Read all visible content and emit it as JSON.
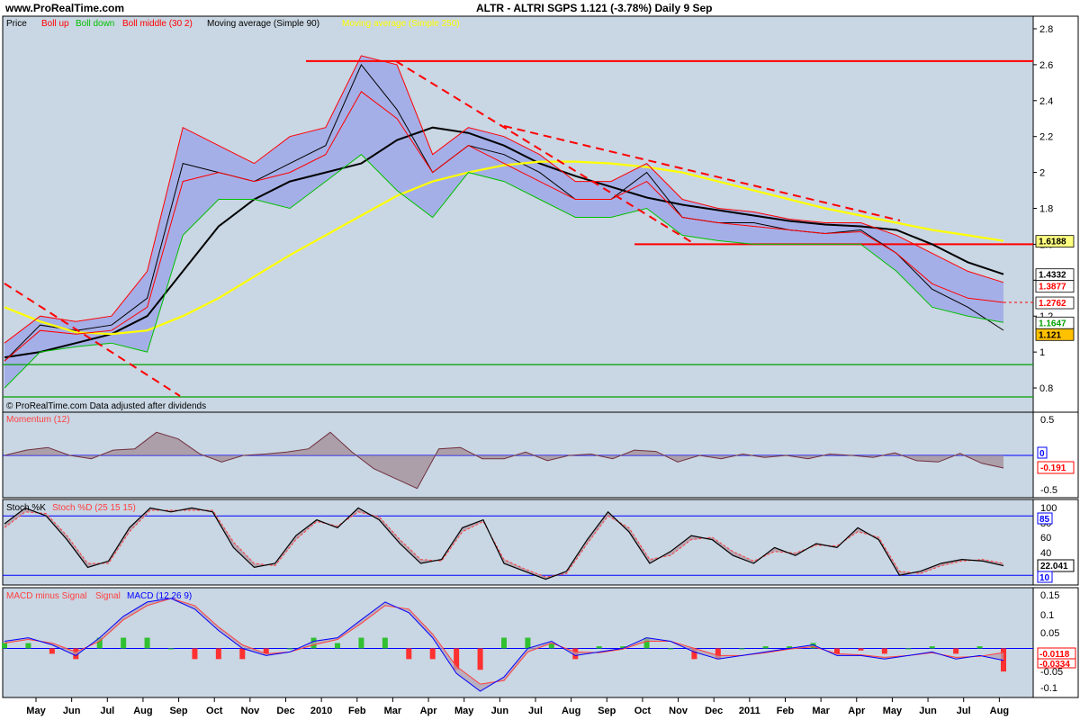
{
  "header": {
    "site": "www.ProRealTime.com",
    "ticker": "ALTR - ALTRI SGPS    1.121 (-3.78%)     Daily  9 Sep"
  },
  "price_panel": {
    "legend": [
      {
        "text": "Price",
        "color": "#000000"
      },
      {
        "text": "Boll up",
        "color": "#ff0000"
      },
      {
        "text": "Boll down",
        "color": "#00c000"
      },
      {
        "text": "Boll middle (30 2)",
        "color": "#ff0000"
      },
      {
        "text": "Moving average (Simple 90)",
        "color": "#000000"
      },
      {
        "text": "Moving average (Simple 250)",
        "color": "#ffff00"
      }
    ],
    "footnote": "© ProRealTime.com  Data adjusted after dividends",
    "y_ticks": [
      "2.8",
      "2.6",
      "2.4",
      "2.2",
      "2",
      "1.8",
      "1.6",
      "1.4",
      "1.2",
      "1",
      "0.8"
    ],
    "tags": [
      {
        "text": "1.6188",
        "bg": "#ffff80",
        "fg": "#000000",
        "value": 1.6188
      },
      {
        "text": "1.4332",
        "bg": "#ffffff",
        "fg": "#000000",
        "value": 1.4332
      },
      {
        "text": "1.3877",
        "bg": "#ffffff",
        "fg": "#ff0000",
        "value": 1.3877
      },
      {
        "text": "1.2762",
        "bg": "#ffffff",
        "fg": "#ff0000",
        "value": 1.2762
      },
      {
        "text": "1.1647",
        "bg": "#ffffff",
        "fg": "#00a000",
        "value": 1.1647
      },
      {
        "text": "1.121",
        "bg": "#ffc000",
        "fg": "#000000",
        "value": 1.121
      }
    ]
  },
  "momentum_panel": {
    "legend": "Momentum (12)",
    "y_ticks": [
      "0.5",
      "-0.5"
    ],
    "tags": [
      {
        "text": "0",
        "fg": "#0000ff"
      },
      {
        "text": "-0.191",
        "fg": "#ff0000"
      }
    ]
  },
  "stoch_panel": {
    "legend_k": "Stoch %K",
    "legend_d": "Stoch %D (25 15 15)",
    "y_ticks": [
      "100",
      "80",
      "60",
      "40",
      "20"
    ],
    "tags": [
      {
        "text": "85",
        "fg": "#0000ff"
      },
      {
        "text": "22.041",
        "fg": "#000000"
      },
      {
        "text": "10",
        "fg": "#0000ff"
      }
    ]
  },
  "macd_panel": {
    "legend_a": "MACD minus Signal",
    "legend_b": "Signal",
    "legend_c": "MACD (12 26 9)",
    "y_ticks": [
      "0.15",
      "0.1",
      "0.05",
      "-0.05",
      "-0.1"
    ],
    "tags": [
      {
        "text": "-0.0118",
        "fg": "#ff0000"
      },
      {
        "text": "-0.0334",
        "fg": "#ff0000"
      }
    ]
  },
  "x_labels": [
    "May",
    "Jun",
    "Jul",
    "Aug",
    "Sep",
    "Oct",
    "Nov",
    "Dec",
    "2010",
    "Feb",
    "Mar",
    "Apr",
    "May",
    "Jun",
    "Jul",
    "Aug",
    "Sep",
    "Oct",
    "Nov",
    "Dec",
    "2011",
    "Feb",
    "Mar",
    "Apr",
    "May",
    "Jun",
    "Jul",
    "Aug",
    "Sep"
  ],
  "chart_data": [
    {
      "type": "line",
      "title": "ALTR - ALTRI SGPS",
      "ylim": [
        0.68,
        2.85
      ],
      "months": [
        "May",
        "Jun",
        "Jul",
        "Aug",
        "Sep",
        "Oct",
        "Nov",
        "Dec",
        "2010",
        "Feb",
        "Mar",
        "Apr",
        "May",
        "Jun",
        "Jul",
        "Aug",
        "Sep",
        "Oct",
        "Nov",
        "Dec",
        "2011",
        "Feb",
        "Mar",
        "Apr",
        "May",
        "Jun",
        "Jul",
        "Aug",
        "Sep"
      ],
      "series": [
        {
          "name": "Price",
          "color": "#000000",
          "values": [
            0.95,
            1.15,
            1.12,
            1.15,
            1.3,
            2.05,
            2.0,
            1.95,
            2.05,
            2.15,
            2.6,
            2.35,
            2.0,
            2.15,
            2.1,
            2.0,
            1.85,
            1.85,
            2.0,
            1.75,
            1.72,
            1.72,
            1.68,
            1.66,
            1.68,
            1.55,
            1.35,
            1.25,
            1.121
          ]
        },
        {
          "name": "Moving average (Simple 90)",
          "color": "#000000",
          "values": [
            0.97,
            1.0,
            1.05,
            1.1,
            1.2,
            1.45,
            1.7,
            1.85,
            1.95,
            2.0,
            2.05,
            2.18,
            2.25,
            2.22,
            2.15,
            2.05,
            1.98,
            1.92,
            1.86,
            1.82,
            1.79,
            1.76,
            1.73,
            1.71,
            1.7,
            1.68,
            1.6,
            1.5,
            1.4332
          ]
        },
        {
          "name": "Moving average (Simple 250)",
          "color": "#ffff00",
          "values": [
            1.25,
            1.17,
            1.11,
            1.1,
            1.12,
            1.2,
            1.3,
            1.42,
            1.54,
            1.65,
            1.76,
            1.87,
            1.95,
            2.0,
            2.04,
            2.06,
            2.06,
            2.05,
            2.03,
            2.0,
            1.95,
            1.9,
            1.85,
            1.8,
            1.76,
            1.72,
            1.68,
            1.65,
            1.6188
          ]
        },
        {
          "name": "Boll up",
          "color": "#ff0000",
          "values": [
            1.05,
            1.2,
            1.17,
            1.2,
            1.45,
            2.25,
            2.15,
            2.05,
            2.2,
            2.25,
            2.65,
            2.6,
            2.1,
            2.25,
            2.2,
            2.1,
            1.95,
            1.95,
            2.05,
            1.85,
            1.8,
            1.78,
            1.74,
            1.72,
            1.72,
            1.65,
            1.55,
            1.45,
            1.3877
          ]
        },
        {
          "name": "Boll middle (30 2)",
          "color": "#ff0000",
          "values": [
            0.95,
            1.12,
            1.1,
            1.12,
            1.25,
            1.95,
            2.0,
            1.95,
            2.0,
            2.1,
            2.45,
            2.3,
            2.0,
            2.15,
            2.05,
            1.95,
            1.85,
            1.85,
            1.95,
            1.75,
            1.72,
            1.7,
            1.68,
            1.66,
            1.67,
            1.55,
            1.38,
            1.3,
            1.2762
          ]
        },
        {
          "name": "Boll down",
          "color": "#00c000",
          "values": [
            0.8,
            1.0,
            1.03,
            1.05,
            1.0,
            1.65,
            1.85,
            1.85,
            1.8,
            1.95,
            2.1,
            1.9,
            1.75,
            2.0,
            1.95,
            1.85,
            1.75,
            1.75,
            1.8,
            1.65,
            1.62,
            1.6,
            1.6,
            1.6,
            1.6,
            1.45,
            1.25,
            1.2,
            1.1647
          ]
        }
      ],
      "hlines": [
        2.62,
        1.6,
        0.93,
        0.75
      ]
    },
    {
      "type": "area",
      "title": "Momentum (12)",
      "ylim": [
        -0.6,
        0.6
      ],
      "series": [
        {
          "name": "Momentum (12)",
          "values": [
            0.0,
            0.08,
            0.12,
            0.0,
            -0.05,
            0.08,
            0.1,
            0.35,
            0.25,
            0.02,
            -0.1,
            0.0,
            0.02,
            0.05,
            0.1,
            0.35,
            0.05,
            -0.2,
            -0.35,
            -0.5,
            0.1,
            0.12,
            -0.05,
            -0.05,
            0.05,
            -0.08,
            0.0,
            0.02,
            -0.05,
            0.08,
            0.06,
            -0.1,
            0.0,
            -0.05,
            0.02,
            -0.03,
            0.0,
            -0.05,
            0.02,
            0.0,
            -0.03,
            0.04,
            -0.08,
            -0.1,
            0.03,
            -0.12,
            -0.191
          ]
        }
      ]
    },
    {
      "type": "line",
      "title": "Stoch %K / Stoch %D (25 15 15)",
      "ylim": [
        0,
        100
      ],
      "series": [
        {
          "name": "Stoch %K",
          "values": [
            75,
            95,
            85,
            55,
            20,
            28,
            70,
            95,
            90,
            95,
            90,
            45,
            20,
            25,
            60,
            80,
            70,
            95,
            80,
            50,
            25,
            30,
            70,
            80,
            25,
            15,
            5,
            15,
            55,
            90,
            65,
            25,
            40,
            60,
            55,
            35,
            25,
            45,
            35,
            50,
            45,
            70,
            55,
            10,
            15,
            25,
            30,
            28,
            22
          ]
        },
        {
          "name": "Stoch %D",
          "values": [
            70,
            90,
            88,
            60,
            25,
            25,
            65,
            92,
            92,
            92,
            92,
            52,
            25,
            22,
            55,
            78,
            72,
            90,
            84,
            55,
            30,
            28,
            65,
            78,
            30,
            18,
            8,
            12,
            50,
            85,
            70,
            30,
            35,
            55,
            58,
            40,
            28,
            40,
            38,
            48,
            47,
            65,
            58,
            15,
            12,
            22,
            28,
            30,
            25
          ]
        }
      ],
      "hlines": [
        85,
        10
      ]
    },
    {
      "type": "bar",
      "title": "MACD (12 26 9)",
      "ylim": [
        -0.13,
        0.16
      ],
      "series": [
        {
          "name": "MACD",
          "values": [
            0.02,
            0.03,
            0.01,
            -0.02,
            0.03,
            0.09,
            0.13,
            0.14,
            0.11,
            0.05,
            0.0,
            -0.02,
            -0.01,
            0.02,
            0.03,
            0.08,
            0.13,
            0.1,
            0.03,
            -0.07,
            -0.12,
            -0.08,
            0.0,
            0.02,
            -0.02,
            -0.01,
            0.0,
            0.03,
            0.02,
            -0.01,
            -0.03,
            -0.02,
            -0.01,
            0.0,
            0.01,
            -0.02,
            -0.02,
            -0.03,
            -0.02,
            -0.01,
            -0.03,
            -0.02,
            -0.0334
          ]
        },
        {
          "name": "Signal",
          "values": [
            0.015,
            0.025,
            0.015,
            -0.01,
            0.02,
            0.08,
            0.12,
            0.14,
            0.12,
            0.06,
            0.01,
            -0.015,
            -0.01,
            0.01,
            0.025,
            0.07,
            0.12,
            0.11,
            0.04,
            -0.05,
            -0.1,
            -0.09,
            -0.01,
            0.015,
            -0.01,
            -0.012,
            -0.002,
            0.02,
            0.02,
            0.0,
            -0.02,
            -0.02,
            -0.012,
            -0.002,
            0.005,
            -0.015,
            -0.018,
            -0.025,
            -0.02,
            -0.012,
            -0.025,
            -0.022,
            -0.0118
          ]
        }
      ]
    }
  ]
}
